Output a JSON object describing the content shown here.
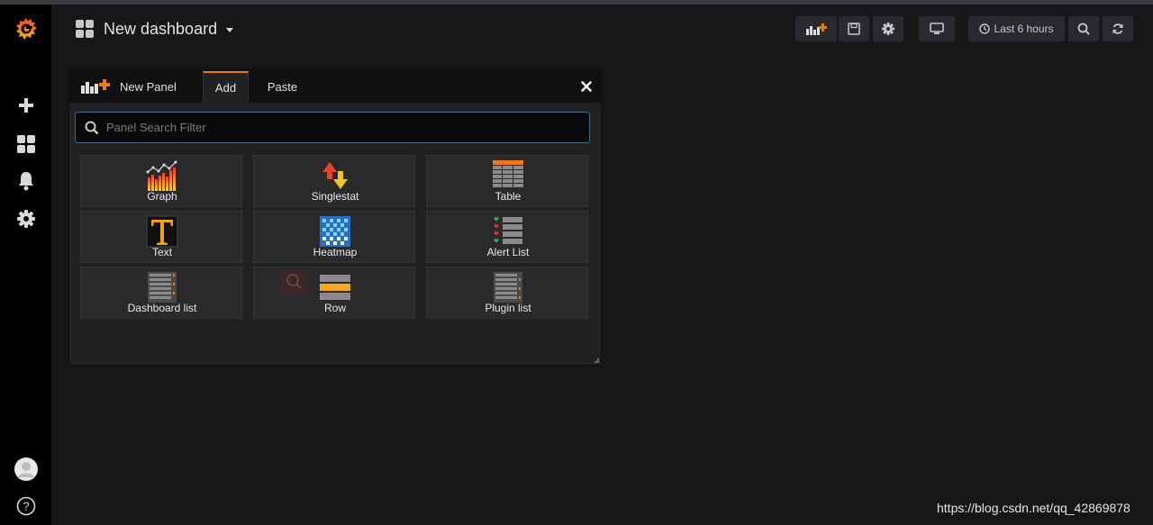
{
  "header": {
    "dashboard_title": "New dashboard",
    "time_range_label": "Last 6 hours",
    "icons": [
      "add-panel-icon",
      "save-icon",
      "gear-icon",
      "tv-icon",
      "clock-icon",
      "zoom-out-icon",
      "refresh-icon"
    ]
  },
  "sidebar": {
    "items": [
      {
        "name": "grafana-logo"
      },
      {
        "name": "plus-icon"
      },
      {
        "name": "dashboards-icon"
      },
      {
        "name": "bell-icon"
      },
      {
        "name": "gear-icon"
      },
      {
        "name": "avatar"
      },
      {
        "name": "help-icon",
        "label": "?"
      }
    ]
  },
  "panel": {
    "title": "New Panel",
    "tabs": [
      "Add",
      "Paste"
    ],
    "active_tab": "Add",
    "close_glyph": "✖",
    "search_placeholder": "Panel Search Filter",
    "panel_types": [
      {
        "label": "Graph",
        "icon": "graph-icon"
      },
      {
        "label": "Singlestat",
        "icon": "singlestat-icon"
      },
      {
        "label": "Table",
        "icon": "table-icon"
      },
      {
        "label": "Text",
        "icon": "text-icon"
      },
      {
        "label": "Heatmap",
        "icon": "heatmap-icon"
      },
      {
        "label": "Alert List",
        "icon": "alert-list-icon"
      },
      {
        "label": "Dashboard list",
        "icon": "dashboard-list-icon"
      },
      {
        "label": "Row",
        "icon": "row-icon"
      },
      {
        "label": "Plugin list",
        "icon": "plugin-list-icon"
      }
    ]
  },
  "watermark": "https://blog.csdn.net/qq_42869878",
  "colors": {
    "accent": "#eb7b18",
    "background": "#161719",
    "sidebar": "#000000",
    "panel": "#212124"
  }
}
